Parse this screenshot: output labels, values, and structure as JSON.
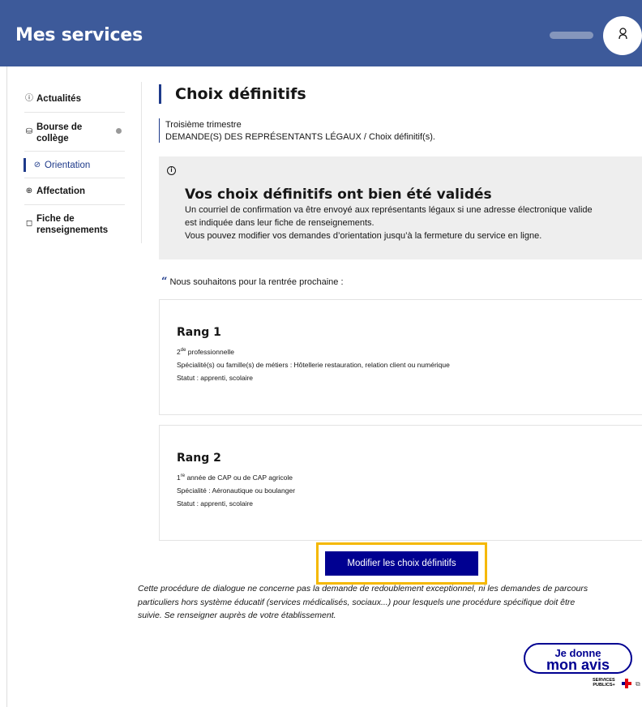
{
  "header": {
    "title": "Mes services",
    "user_icon": "user-icon"
  },
  "sidebar": {
    "items": [
      {
        "icon": "ⓘ",
        "icon_name": "info-icon",
        "label": "Actualités"
      },
      {
        "icon": "⛁",
        "icon_name": "money-icon",
        "label_line1": "Bourse de",
        "label_line2": "collège"
      },
      {
        "icon": "⊘",
        "icon_name": "compass-icon",
        "label": "Orientation"
      },
      {
        "icon": "⊕",
        "icon_name": "target-icon",
        "label": "Affectation"
      },
      {
        "icon": "◻",
        "icon_name": "file-icon",
        "label_line1": "Fiche de",
        "label_line2": "renseignements"
      }
    ]
  },
  "page": {
    "title": "Choix définitifs",
    "crumb_line1": "Troisième trimestre",
    "crumb_line2": "DEMANDE(S) DES REPRÉSENTANTS LÉGAUX / Choix définitif(s)."
  },
  "notice": {
    "title": "Vos choix définitifs ont bien été validés",
    "line1": "Un courriel de confirmation va être envoyé aux représentants légaux si une adresse électronique valide",
    "line2": "est indiquée dans leur fiche de renseignements.",
    "line3": "Vous pouvez modifier vos demandes d’orientation jusqu’à la fermeture du service en ligne."
  },
  "quote": "Nous souhaitons pour la rentrée prochaine :",
  "ranks": [
    {
      "title": "Rang 1",
      "line1_base": "2",
      "line1_sup": "de",
      "line1_rest": " professionnelle",
      "line2": "Spécialité(s) ou famille(s) de métiers : Hôtellerie restauration, relation client ou numérique",
      "line3": "Statut : apprenti, scolaire"
    },
    {
      "title": "Rang 2",
      "line1_base": "1",
      "line1_sup": "re",
      "line1_rest": " année de CAP ou de CAP agricole",
      "line2": "Spécialité : Aéronautique ou boulanger",
      "line3": "Statut : apprenti, scolaire"
    }
  ],
  "modify_button": "Modifier les choix définitifs",
  "disclaimer": {
    "line1": "Cette procédure de dialogue ne concerne pas la demande de redoublement exceptionnel, ni les demandes de parcours",
    "line2": "particuliers hors système éducatif (services médicalisés, sociaux...) pour lesquels une procédure spécifique doit être",
    "line3": "suivie. Se renseigner auprès de votre établissement."
  },
  "feedback": {
    "line1": "Je donne",
    "line2": "mon avis",
    "brand_line1": "SERVICES",
    "brand_line2": "PUBLICS+"
  },
  "colors": {
    "header_bg": "#3d5a9a",
    "accent": "#000091",
    "focus": "#f5b800",
    "notice_bg": "#eeeeee"
  }
}
